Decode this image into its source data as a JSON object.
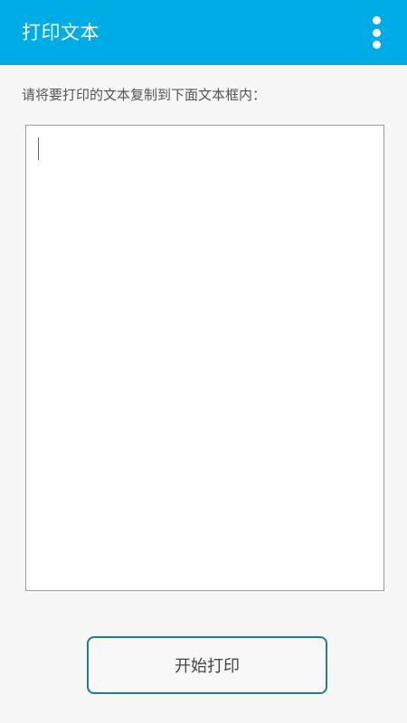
{
  "app_bar": {
    "title": "打印文本",
    "menu_icon": "more-vertical-icon",
    "background_color": "#00ace6"
  },
  "main": {
    "instruction": "请将要打印的文本复制到下面文本框内：",
    "text_input": {
      "value": "",
      "placeholder": ""
    },
    "start_print_label": "开始打印",
    "button_border_color": "#1f7f86"
  }
}
